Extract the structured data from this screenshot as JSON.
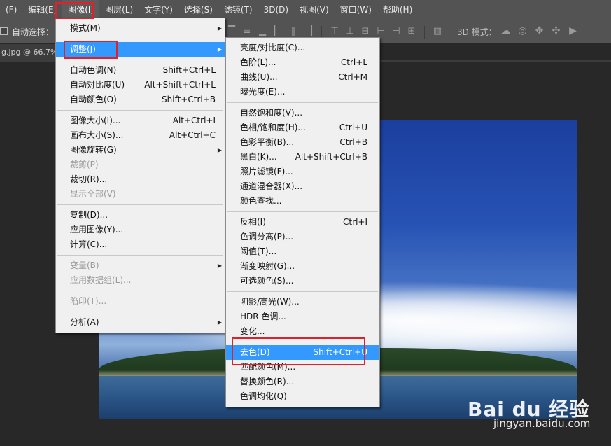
{
  "menubar": {
    "items": [
      {
        "label": "(F)"
      },
      {
        "label": "编辑(E)"
      },
      {
        "label": "图像(I)",
        "active": true
      },
      {
        "label": "图层(L)"
      },
      {
        "label": "文字(Y)"
      },
      {
        "label": "选择(S)"
      },
      {
        "label": "滤镜(T)"
      },
      {
        "label": "3D(D)"
      },
      {
        "label": "视图(V)"
      },
      {
        "label": "窗口(W)"
      },
      {
        "label": "帮助(H)"
      }
    ]
  },
  "options": {
    "auto_select_label": "自动选择：",
    "mode_3d_label": "3D 模式：",
    "align_icons": [
      "align-top-icon",
      "align-vcenter-icon",
      "align-bottom-icon",
      "align-left-icon",
      "align-hcenter-icon",
      "align-right-icon",
      "dist-top-icon",
      "dist-vcenter-icon",
      "dist-bottom-icon",
      "dist-left-icon",
      "dist-hcenter-icon",
      "dist-right-icon",
      "auto-align-icon"
    ],
    "icons_3d": [
      "orbit-icon",
      "roll-icon",
      "pan-icon",
      "slide-icon",
      "scale-icon"
    ]
  },
  "document": {
    "tab_label": "g.jpg @ 66.7%"
  },
  "image_menu": {
    "items": [
      {
        "label": "模式(M)",
        "submenu": true
      },
      {
        "sep": true
      },
      {
        "label": "调整(J)",
        "submenu": true,
        "highlight": true
      },
      {
        "sep": true
      },
      {
        "label": "自动色调(N)",
        "shortcut": "Shift+Ctrl+L"
      },
      {
        "label": "自动对比度(U)",
        "shortcut": "Alt+Shift+Ctrl+L"
      },
      {
        "label": "自动颜色(O)",
        "shortcut": "Shift+Ctrl+B"
      },
      {
        "sep": true
      },
      {
        "label": "图像大小(I)...",
        "shortcut": "Alt+Ctrl+I"
      },
      {
        "label": "画布大小(S)...",
        "shortcut": "Alt+Ctrl+C"
      },
      {
        "label": "图像旋转(G)",
        "submenu": true
      },
      {
        "label": "裁剪(P)",
        "disabled": true
      },
      {
        "label": "裁切(R)..."
      },
      {
        "label": "显示全部(V)",
        "disabled": true
      },
      {
        "sep": true
      },
      {
        "label": "复制(D)..."
      },
      {
        "label": "应用图像(Y)..."
      },
      {
        "label": "计算(C)..."
      },
      {
        "sep": true
      },
      {
        "label": "变量(B)",
        "submenu": true,
        "disabled": true
      },
      {
        "label": "应用数据组(L)...",
        "disabled": true
      },
      {
        "sep": true
      },
      {
        "label": "陷印(T)...",
        "disabled": true
      },
      {
        "sep": true
      },
      {
        "label": "分析(A)",
        "submenu": true
      }
    ]
  },
  "adjust_menu": {
    "items": [
      {
        "label": "亮度/对比度(C)..."
      },
      {
        "label": "色阶(L)...",
        "shortcut": "Ctrl+L"
      },
      {
        "label": "曲线(U)...",
        "shortcut": "Ctrl+M"
      },
      {
        "label": "曝光度(E)..."
      },
      {
        "sep": true
      },
      {
        "label": "自然饱和度(V)..."
      },
      {
        "label": "色相/饱和度(H)...",
        "shortcut": "Ctrl+U"
      },
      {
        "label": "色彩平衡(B)...",
        "shortcut": "Ctrl+B"
      },
      {
        "label": "黑白(K)...",
        "shortcut": "Alt+Shift+Ctrl+B"
      },
      {
        "label": "照片滤镜(F)..."
      },
      {
        "label": "通道混合器(X)..."
      },
      {
        "label": "颜色查找..."
      },
      {
        "sep": true
      },
      {
        "label": "反相(I)",
        "shortcut": "Ctrl+I"
      },
      {
        "label": "色调分离(P)..."
      },
      {
        "label": "阈值(T)..."
      },
      {
        "label": "渐变映射(G)..."
      },
      {
        "label": "可选颜色(S)..."
      },
      {
        "sep": true
      },
      {
        "label": "阴影/高光(W)..."
      },
      {
        "label": "HDR 色调..."
      },
      {
        "label": "变化..."
      },
      {
        "sep": true
      },
      {
        "label": "去色(D)",
        "shortcut": "Shift+Ctrl+U",
        "highlight": true
      },
      {
        "label": "匹配颜色(M)..."
      },
      {
        "label": "替换颜色(R)..."
      },
      {
        "label": "色调均化(Q)"
      }
    ]
  },
  "watermark": {
    "brand": "Bai du 经验",
    "url": "jingyan.baidu.com"
  },
  "colors": {
    "menu_bg": "#f0f0f0",
    "highlight": "#3399ff",
    "annotation": "#e0202a",
    "chrome": "#535353"
  }
}
